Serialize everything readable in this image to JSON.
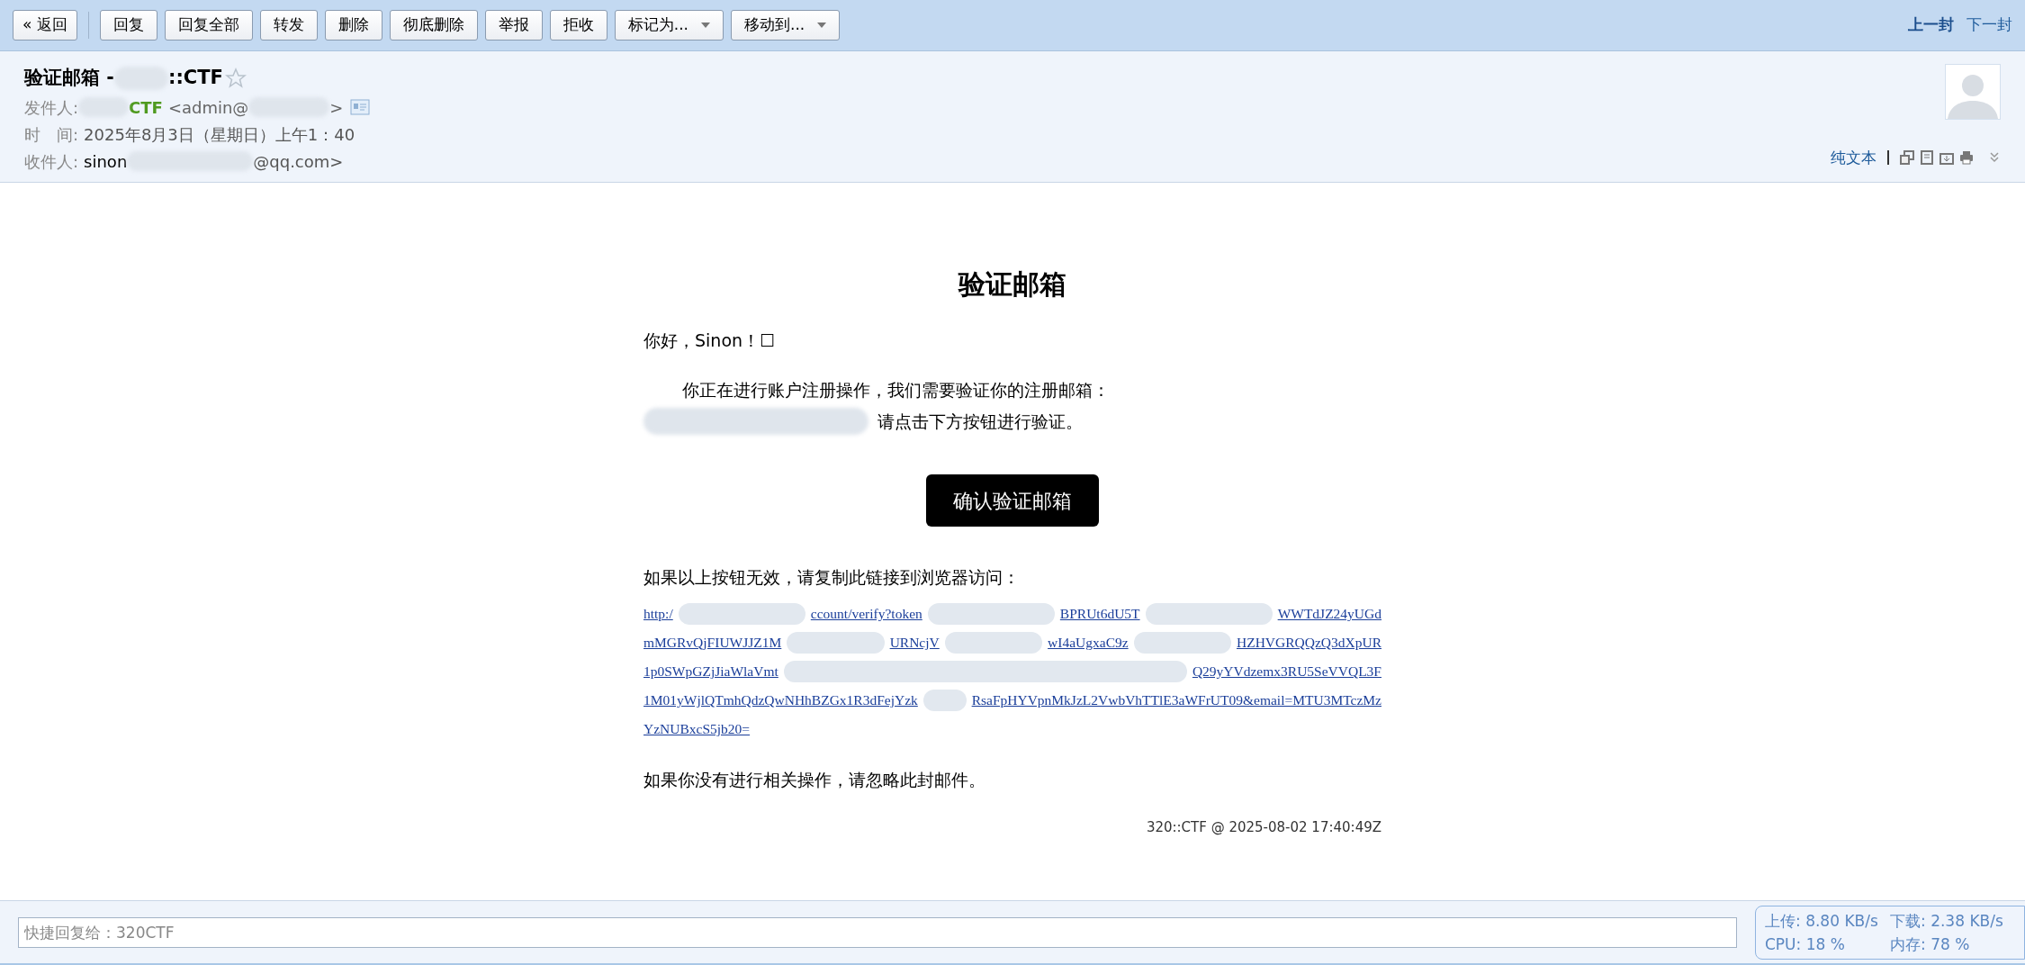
{
  "toolbar": {
    "back": "« 返回",
    "buttons": [
      {
        "label": "回复",
        "kind": "button"
      },
      {
        "label": "回复全部",
        "kind": "button"
      },
      {
        "label": "转发",
        "kind": "button"
      },
      {
        "label": "删除",
        "kind": "button"
      },
      {
        "label": "彻底删除",
        "kind": "button"
      },
      {
        "label": "举报",
        "kind": "button"
      },
      {
        "label": "拒收",
        "kind": "button"
      },
      {
        "label": "标记为...",
        "kind": "dropdown"
      },
      {
        "label": "移动到...",
        "kind": "dropdown"
      }
    ],
    "nav": [
      {
        "label": "上一封",
        "selected": true
      },
      {
        "label": "下一封",
        "selected": false
      }
    ]
  },
  "header": {
    "subject_start": "验证邮箱 -",
    "subject_end": "::CTF",
    "starred": false,
    "from_label": "发件人:",
    "from_name": "CTF",
    "from_addr_start": "<admin@",
    "from_addr_end": ">",
    "time_label": "时　间:",
    "time": "2025年8月3日（星期日）上午1：40",
    "to_label": "收件人:",
    "to_name": "sinon",
    "to_addr_end": "@qq.com>",
    "plain_text": "纯文本"
  },
  "email": {
    "title": "验证邮箱",
    "greeting": "你好，Sinon！☐",
    "intro": "你正在进行账户注册操作，我们需要验证你的注册邮箱：",
    "intro_end": "请点击下方按钮进行验证。",
    "button": "确认验证邮箱",
    "fallback": "如果以上按钮无效，请复制此链接到浏览器访问：",
    "link_lines": [
      [
        "http:/",
        "ccount/verify?token",
        "BPRUt6dU5T",
        "WWTdJZ24yUGd"
      ],
      [
        "mMGRvQjFIUWJJZ1M",
        "URNcjV",
        "wI4aUgxaC9z",
        "HZHVGRQQzQ3dXpUR"
      ],
      [
        "1p0SWpGZjJiaWlaVmt",
        "Q29yYVdzemx3RU5SeVVQL3F"
      ],
      [
        "1M01yWjlQTmhQdzQwNHhBZGx1R3dFejYzk",
        "RsaFpHYVpnMkJzL2VwbVhTTlE3aWFrUT09&email=MTU3MTczMz"
      ],
      [
        "YzNUBxcS5jb20="
      ]
    ],
    "ignore": "如果你没有进行相关操作，请忽略此封邮件。",
    "signature": "320::CTF @ 2025-08-02 17:40:49Z"
  },
  "quick_reply": {
    "placeholder": "快捷回复给：320CTF"
  },
  "net_monitor": {
    "upload": "上传: 8.80 KB/s",
    "download": "下载: 2.38 KB/s",
    "cpu": "CPU: 18 %",
    "memory": "内存: 78 %"
  }
}
